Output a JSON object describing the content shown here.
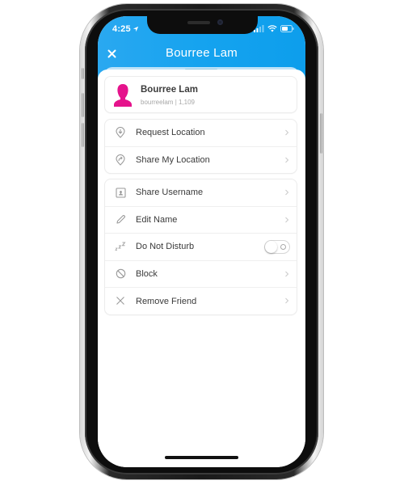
{
  "status_bar": {
    "time": "4:25",
    "icons": [
      "location-arrow-icon",
      "cellular-signal-icon",
      "wifi-icon",
      "battery-icon"
    ]
  },
  "header": {
    "title": "Bourree Lam",
    "close_icon": "close-icon"
  },
  "profile": {
    "name": "Bourree Lam",
    "subtitle": "bourreelam | 1,109",
    "avatar_color": "#e5138c"
  },
  "location_section": {
    "items": [
      {
        "label": "Request Location",
        "icon": "location-pin-down-icon"
      },
      {
        "label": "Share My Location",
        "icon": "location-pin-share-icon"
      }
    ]
  },
  "options_section": {
    "items": [
      {
        "label": "Share Username",
        "icon": "username-card-icon"
      },
      {
        "label": "Edit Name",
        "icon": "pencil-icon"
      },
      {
        "label": "Do Not Disturb",
        "icon": "zzz-icon",
        "toggle": false
      },
      {
        "label": "Block",
        "icon": "block-icon"
      },
      {
        "label": "Remove Friend",
        "icon": "x-icon"
      }
    ]
  },
  "colors": {
    "header_blue": "#15a3ef",
    "avatar_pink": "#e5138c"
  }
}
